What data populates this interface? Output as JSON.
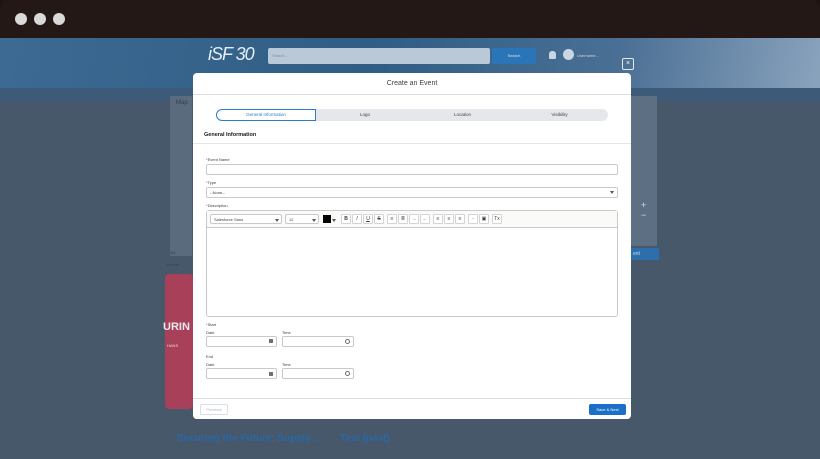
{
  "app": {
    "logo": "iSF 30",
    "search_placeholder": "Search...",
    "search_button": "Search",
    "user_menu": "Username..."
  },
  "background": {
    "map_label": "Map",
    "card_text": "URIN",
    "card_sub": "HANS",
    "title_1": "Securing the Future: Supply ...",
    "title_2": "Test (past)",
    "right_button": "ent"
  },
  "modal": {
    "title": "Create an Event",
    "close": "×",
    "steps": [
      {
        "label": "General Information",
        "active": true
      },
      {
        "label": "Logo",
        "active": false
      },
      {
        "label": "Location",
        "active": false
      },
      {
        "label": "Visibility",
        "active": false
      }
    ],
    "section_title": "General Information",
    "event_name_label": "Event Name",
    "type_label": "Type",
    "type_value": "--None--",
    "description_label": "Description",
    "toolbar": {
      "font": "Salesforce Sans",
      "size": "12",
      "bold": "B",
      "italic": "I",
      "underline": "U",
      "strike": "S",
      "clear": "Tx"
    },
    "start_label": "Start",
    "end_label": "End",
    "date_label": "Date",
    "time_label": "Time",
    "previous_button": "Previous",
    "next_button": "Save & Next"
  }
}
